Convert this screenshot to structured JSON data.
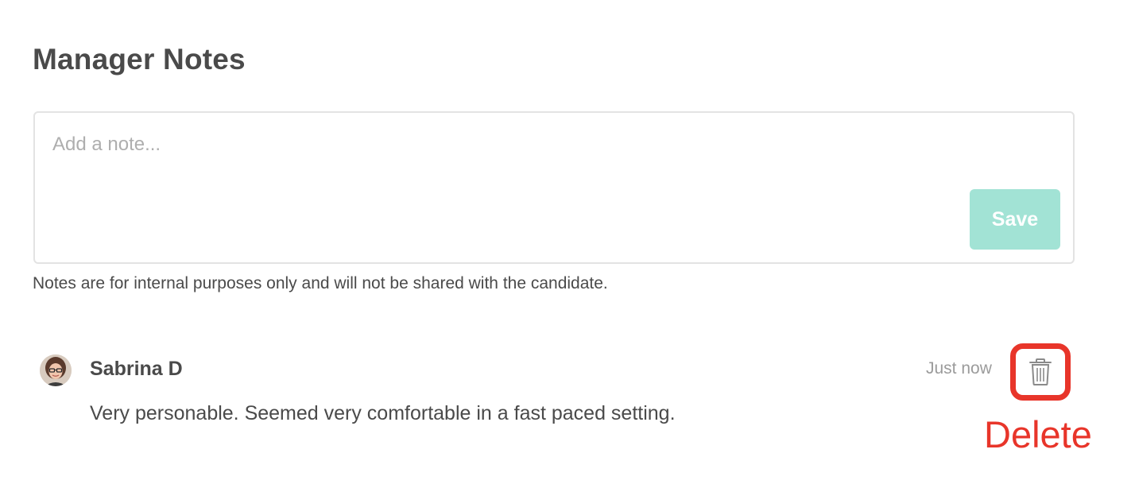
{
  "header": {
    "title": "Manager Notes"
  },
  "composer": {
    "value": "",
    "placeholder": "Add a note...",
    "save_label": "Save",
    "save_color": "#a2e3d5"
  },
  "disclaimer": "Notes are for internal purposes only and will not be shared with the candidate.",
  "notes": [
    {
      "author": "Sabrina D",
      "timestamp": "Just now",
      "body": "Very personable. Seemed very comfortable in a fast paced setting.",
      "delete_icon": "trash-icon"
    }
  ],
  "annotation": {
    "label": "Delete",
    "color": "#e8352a"
  }
}
